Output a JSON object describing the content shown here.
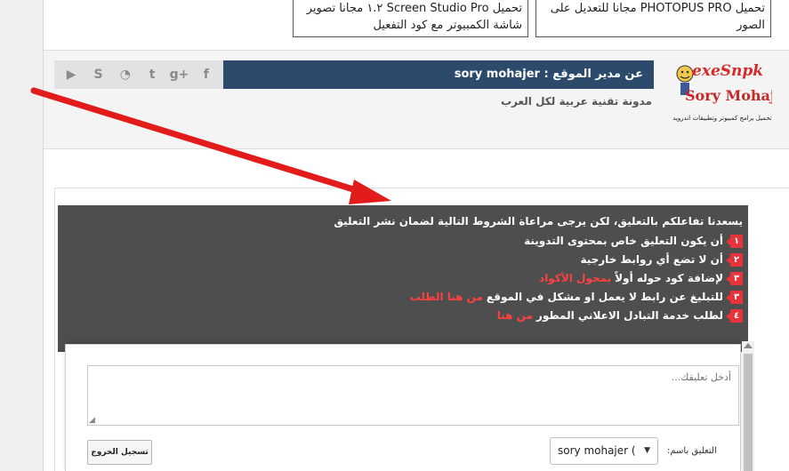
{
  "related": [
    {
      "title": "تحميل PHOTOPUS PRO مجانا للتعديل على الصور"
    },
    {
      "title": "تحميل Screen Studio Pro ١.٢ مجانا تصوير شاشة الكمبيوتر مع كود التفعيل"
    }
  ],
  "author": {
    "label": "عن مدير الموقع : sory mohajer",
    "description": "مدونة تقنية عربية لكل العرب",
    "logo_top": "exeSnpk",
    "logo_name": "Sory Mohajer",
    "logo_tagline": "تحميل برامج كمبيوتر وتطبيقات اندرويد"
  },
  "social": [
    {
      "icon": "youtube-icon",
      "glyph": "▶"
    },
    {
      "icon": "skype-icon",
      "glyph": "S"
    },
    {
      "icon": "rss-icon",
      "glyph": "◔"
    },
    {
      "icon": "twitter-icon",
      "glyph": "t"
    },
    {
      "icon": "google-plus-icon",
      "glyph": "g+"
    },
    {
      "icon": "facebook-icon",
      "glyph": "f"
    }
  ],
  "rules": {
    "title": "يسعدنا تفاعلكم بالتعليق، لكن يرجى مراعاة الشروط التالية لضمان نشر التعليق",
    "items": [
      {
        "num": "١",
        "text": "أن يكون التعليق خاص بمحتوى التدوينة",
        "link": ""
      },
      {
        "num": "٢",
        "text": "أن لا تضع أي روابط خارجية",
        "link": ""
      },
      {
        "num": "٣",
        "text": "لإضافة كود حوله أولاً",
        "link": "بمحول الأكواد"
      },
      {
        "num": "٣",
        "text": "للتبليغ عن رابط لا يعمل او مشكل في الموقع",
        "link": "من هنا الطلب"
      },
      {
        "num": "٤",
        "text": "لطلب خدمة التبادل الاعلاني المطور",
        "link": "من هنا"
      }
    ]
  },
  "form": {
    "placeholder": "أدخل تعليقك...",
    "comment_as_label": "التعليق باسم:",
    "selected_identity": "sory mohajer (",
    "logout_label": "تسجيل الخروج"
  },
  "colors": {
    "author_bar": "#2c4a6b",
    "rules_bg": "#4e4e4e",
    "badge": "#e8333b",
    "arrow": "#e21b1b"
  }
}
